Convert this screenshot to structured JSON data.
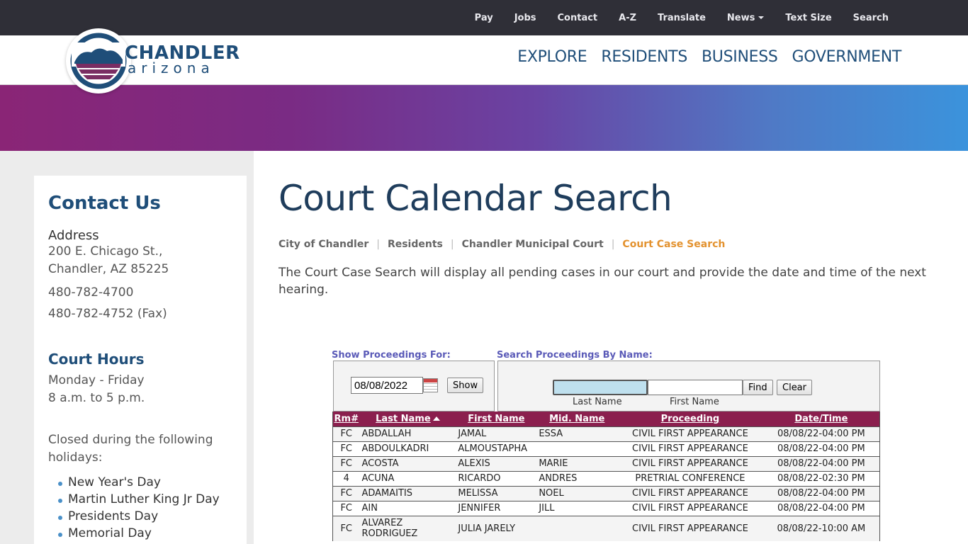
{
  "utility_nav": [
    {
      "label": "Pay"
    },
    {
      "label": "Jobs"
    },
    {
      "label": "Contact"
    },
    {
      "label": "A-Z"
    },
    {
      "label": "Translate"
    },
    {
      "label": "News"
    },
    {
      "label": "Text Size"
    },
    {
      "label": "Search"
    }
  ],
  "logo": {
    "main": "CHANDLER",
    "sub": "arizona"
  },
  "main_nav": [
    {
      "label": "EXPLORE"
    },
    {
      "label": "RESIDENTS"
    },
    {
      "label": "BUSINESS"
    },
    {
      "label": "GOVERNMENT"
    }
  ],
  "sidebar": {
    "title": "Contact Us",
    "address_label": "Address",
    "address_line1": "200 E. Chicago St.,",
    "address_line2": "Chandler, AZ 85225",
    "phone": "480-782-4700",
    "fax": "480-782-4752 (Fax)",
    "hours_title": "Court Hours",
    "hours_days": "Monday - Friday",
    "hours_time": "8 a.m. to 5 p.m.",
    "closed_text": "Closed during the following holidays:",
    "holidays": [
      "New Year's Day",
      "Martin Luther King Jr Day",
      "Presidents Day",
      "Memorial Day"
    ]
  },
  "page": {
    "title": "Court Calendar Search",
    "breadcrumb": [
      "City of Chandler",
      "Residents",
      "Chandler Municipal Court",
      "Court Case Search"
    ],
    "intro": "The Court Case Search will display all pending cases in our court and provide the date and time of the next hearing."
  },
  "search": {
    "show_label": "Show Proceedings For:",
    "name_label": "Search Proceedings By Name:",
    "date_value": "08/08/2022",
    "show_button": "Show",
    "find_button": "Find",
    "clear_button": "Clear",
    "last_name_sub": "Last Name",
    "first_name_sub": "First Name",
    "last_name_value": "",
    "first_name_value": ""
  },
  "table": {
    "headers": [
      "Rm#",
      "Last Name",
      "First Name",
      "Mid. Name",
      "Proceeding",
      "Date/Time"
    ],
    "rows": [
      [
        "FC",
        "ABDALLAH",
        "JAMAL",
        "ESSA",
        "CIVIL FIRST APPEARANCE",
        "08/08/22-04:00 PM"
      ],
      [
        "FC",
        "ABDOULKADRI",
        "ALMOUSTAPHA",
        "",
        "CIVIL FIRST APPEARANCE",
        "08/08/22-04:00 PM"
      ],
      [
        "FC",
        "ACOSTA",
        "ALEXIS",
        "MARIE",
        "CIVIL FIRST APPEARANCE",
        "08/08/22-04:00 PM"
      ],
      [
        "4",
        "ACUNA",
        "RICARDO",
        "ANDRES",
        "PRETRIAL CONFERENCE",
        "08/08/22-02:30 PM"
      ],
      [
        "FC",
        "ADAMAITIS",
        "MELISSA",
        "NOEL",
        "CIVIL FIRST APPEARANCE",
        "08/08/22-04:00 PM"
      ],
      [
        "FC",
        "AIN",
        "JENNIFER",
        "JILL",
        "CIVIL FIRST APPEARANCE",
        "08/08/22-04:00 PM"
      ],
      [
        "FC",
        "ALVAREZ RODRIGUEZ",
        "JULIA JARELY",
        "",
        "CIVIL FIRST APPEARANCE",
        "08/08/22-10:00 AM"
      ]
    ]
  },
  "colors": {
    "brand_blue": "#1f4e79",
    "header_bar": "#2f2f37",
    "table_header": "#8b1f4e",
    "breadcrumb_current": "#e3922f"
  }
}
